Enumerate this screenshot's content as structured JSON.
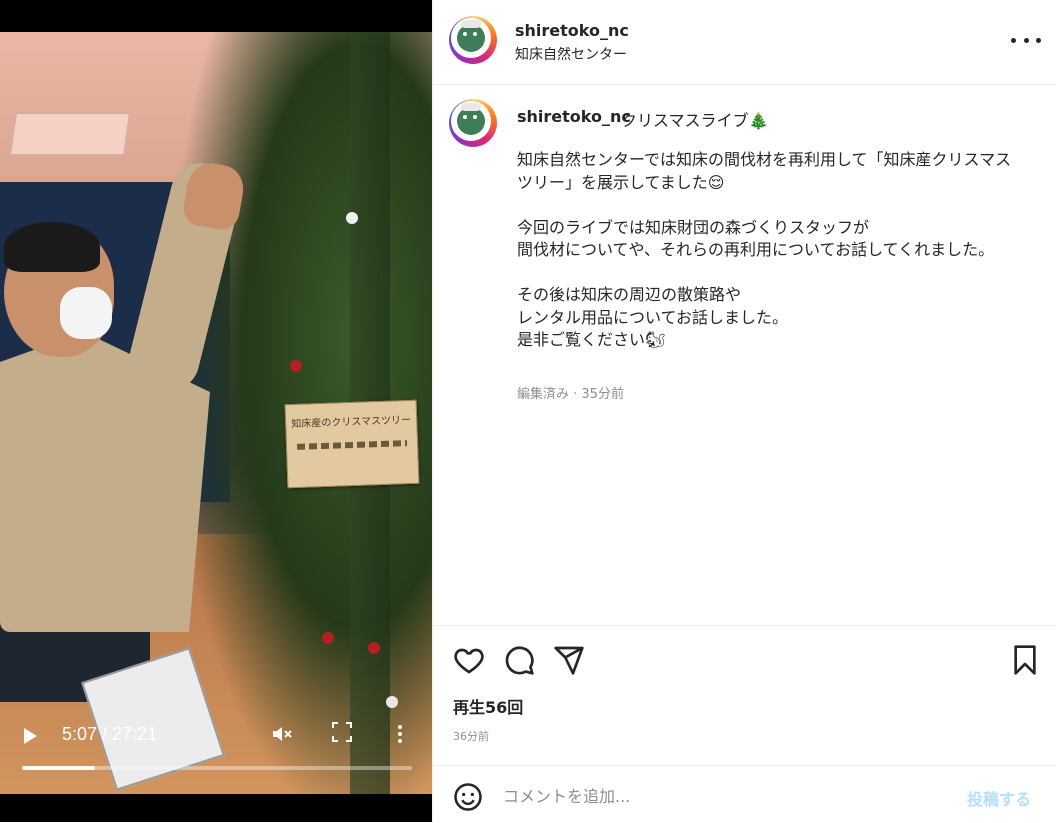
{
  "video": {
    "current_time": "5:07",
    "duration": "27:21",
    "time_display": "5:07 / 27:21",
    "progress": 0.187,
    "sign_text": "知床産のクリスマスツリー"
  },
  "header": {
    "username": "shiretoko_nc",
    "subtitle": "知床自然センター",
    "more_icon": "more-horizontal-icon"
  },
  "caption": {
    "username": "shiretoko_nc",
    "title": "クリスマスライブ🎄",
    "body": "知床自然センターでは知床の間伐材を再利用して「知床産クリスマスツリー」を展示してました😌\n\n今回のライブでは知床財団の森づくりスタッフが\n間伐材についてや、それらの再利用についてお話してくれました。\n\nその後は知床の周辺の散策路や\nレンタル用品についてお話しました。\n是非ご覧ください🐿",
    "meta": "編集済み · 35分前"
  },
  "actions": {
    "plays": "再生56回",
    "posted_ago": "36分前"
  },
  "comment": {
    "placeholder": "コメントを追加...",
    "post_label": "投稿する"
  },
  "colors": {
    "text": "#262626",
    "muted": "#8e8e8e",
    "post_disabled": "#b2dffc",
    "border": "#efefef"
  }
}
